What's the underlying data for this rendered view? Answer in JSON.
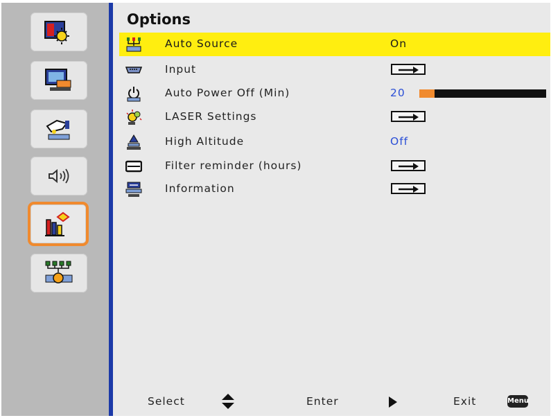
{
  "menu": {
    "title": "Options",
    "items": [
      {
        "label": "Auto Source",
        "value": "On",
        "icon": "auto-source-icon",
        "selected": true
      },
      {
        "label": "Input",
        "icon": "input-connector-icon"
      },
      {
        "label": "Auto Power Off (Min)",
        "value": "20",
        "level": 0.12,
        "icon": "power-timer-icon"
      },
      {
        "label": "LASER Settings",
        "icon": "laser-bulb-icon"
      },
      {
        "label": "High Altitude",
        "value": "Off",
        "icon": "high-altitude-icon"
      },
      {
        "label": "Filter reminder (hours)",
        "icon": "filter-icon"
      },
      {
        "label": "Information",
        "icon": "information-icon"
      }
    ]
  },
  "sidebar": {
    "tabs": [
      {
        "name": "image-settings-icon"
      },
      {
        "name": "display-settings-icon"
      },
      {
        "name": "setup-icon"
      },
      {
        "name": "audio-icon"
      },
      {
        "name": "options-icon",
        "active": true
      },
      {
        "name": "network-icon"
      }
    ]
  },
  "footer": {
    "select_label": "Select",
    "enter_label": "Enter",
    "exit_label": "Exit",
    "menu_key": "Menu"
  },
  "colors": {
    "highlight": "#ffee10",
    "accent": "#f08a2e",
    "divider": "#1c3aa8",
    "value_text": "#2b4fd6"
  }
}
